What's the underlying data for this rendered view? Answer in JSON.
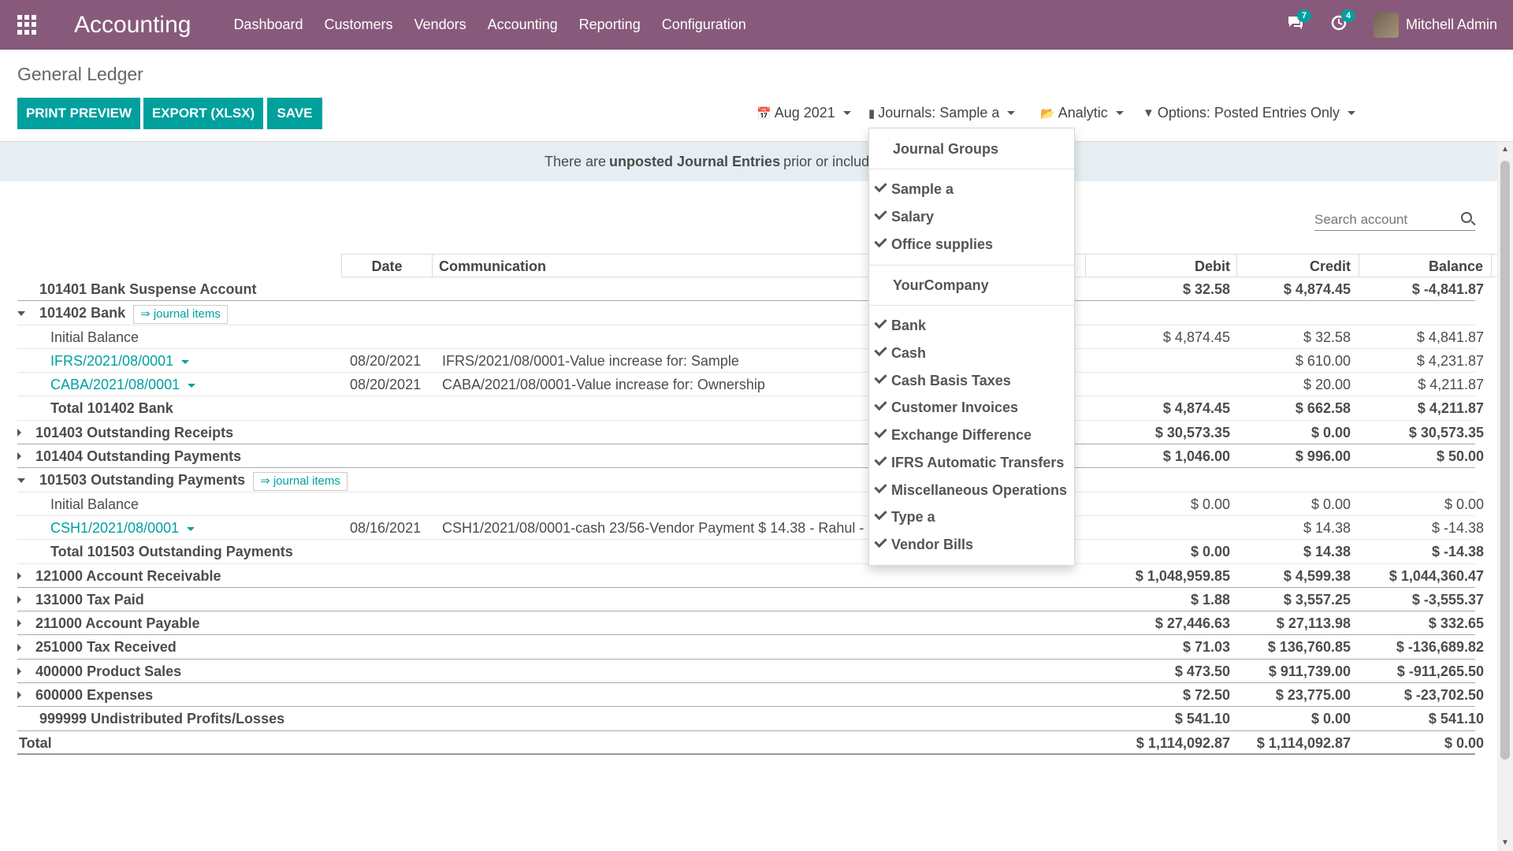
{
  "navbar": {
    "app_title": "Accounting",
    "menu": [
      "Dashboard",
      "Customers",
      "Vendors",
      "Accounting",
      "Reporting",
      "Configuration"
    ],
    "messages_count": "7",
    "activities_count": "4",
    "user_name": "Mitchell Admin"
  },
  "page": {
    "title": "General Ledger",
    "buttons": {
      "print": "PRINT PREVIEW",
      "export": "EXPORT (XLSX)",
      "save": "SAVE"
    },
    "filters": {
      "date": "Aug 2021",
      "journals": "Journals: Sample a",
      "analytic": "Analytic",
      "options": "Options: Posted Entries Only"
    },
    "alert": {
      "prefix": "There are",
      "bold": "unposted Journal Entries",
      "suffix": "prior or included"
    },
    "search_placeholder": "Search account"
  },
  "table": {
    "headers": {
      "date": "Date",
      "communication": "Communication",
      "debit": "Debit",
      "credit": "Credit",
      "balance": "Balance"
    },
    "journal_items_label": "⇒ journal items",
    "rows": [
      {
        "label": "101401 Bank Suspense Account",
        "debit": "$ 32.58",
        "credit": "$ 4,874.45",
        "balance": "$ -4,841.87"
      },
      {
        "label": "101402 Bank"
      },
      {
        "label": "Initial Balance",
        "debit": "$ 4,874.45",
        "credit": "$ 32.58",
        "balance": "$ 4,841.87"
      },
      {
        "label": "IFRS/2021/08/0001",
        "date": "08/20/2021",
        "comm": "IFRS/2021/08/0001-Value increase for: Sample",
        "credit": "$ 610.00",
        "balance": "$ 4,231.87"
      },
      {
        "label": "CABA/2021/08/0001",
        "date": "08/20/2021",
        "comm": "CABA/2021/08/0001-Value increase for: Ownership",
        "credit": "$ 20.00",
        "balance": "$ 4,211.87"
      },
      {
        "label": "Total 101402 Bank",
        "debit": "$ 4,874.45",
        "credit": "$ 662.58",
        "balance": "$ 4,211.87"
      },
      {
        "label": "101403 Outstanding Receipts",
        "debit": "$ 30,573.35",
        "credit": "$ 0.00",
        "balance": "$ 30,573.35"
      },
      {
        "label": "101404 Outstanding Payments",
        "debit": "$ 1,046.00",
        "credit": "$ 996.00",
        "balance": "$ 50.00"
      },
      {
        "label": "101503 Outstanding Payments"
      },
      {
        "label": "Initial Balance",
        "debit": "$ 0.00",
        "credit": "$ 0.00",
        "balance": "$ 0.00"
      },
      {
        "label": "CSH1/2021/08/0001",
        "date": "08/16/2021",
        "comm": "CSH1/2021/08/0001-cash 23/56-Vendor Payment $ 14.38 - Rahul - 0",
        "credit": "$ 14.38",
        "balance": "$ -14.38"
      },
      {
        "label": "Total 101503 Outstanding Payments",
        "debit": "$ 0.00",
        "credit": "$ 14.38",
        "balance": "$ -14.38"
      },
      {
        "label": "121000 Account Receivable",
        "debit": "$ 1,048,959.85",
        "credit": "$ 4,599.38",
        "balance": "$ 1,044,360.47"
      },
      {
        "label": "131000 Tax Paid",
        "debit": "$ 1.88",
        "credit": "$ 3,557.25",
        "balance": "$ -3,555.37"
      },
      {
        "label": "211000 Account Payable",
        "debit": "$ 27,446.63",
        "credit": "$ 27,113.98",
        "balance": "$ 332.65"
      },
      {
        "label": "251000 Tax Received",
        "debit": "$ 71.03",
        "credit": "$ 136,760.85",
        "balance": "$ -136,689.82"
      },
      {
        "label": "400000 Product Sales",
        "debit": "$ 473.50",
        "credit": "$ 911,739.00",
        "balance": "$ -911,265.50"
      },
      {
        "label": "600000 Expenses",
        "debit": "$ 72.50",
        "credit": "$ 23,775.00",
        "balance": "$ -23,702.50"
      },
      {
        "label": "999999 Undistributed Profits/Losses",
        "debit": "$ 541.10",
        "credit": "$ 0.00",
        "balance": "$ 541.10"
      },
      {
        "label": "Total",
        "debit": "$ 1,114,092.87",
        "credit": "$ 1,114,092.87",
        "balance": "$ 0.00"
      }
    ]
  },
  "dropdown": {
    "group_header": "Journal Groups",
    "groups": [
      "Sample a",
      "Salary",
      "Office supplies"
    ],
    "company": "YourCompany",
    "journals": [
      "Bank",
      "Cash",
      "Cash Basis Taxes",
      "Customer Invoices",
      "Exchange Difference",
      "IFRS Automatic Transfers",
      "Miscellaneous Operations",
      "Type a",
      "Vendor Bills"
    ]
  },
  "colors": {
    "brand": "#875a7b",
    "primary": "#00a09d",
    "alert_bg": "#e6eef3"
  }
}
